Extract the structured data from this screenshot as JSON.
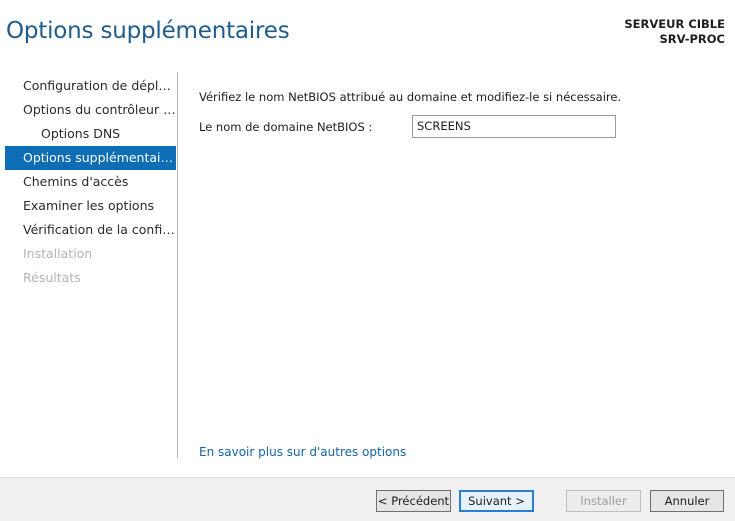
{
  "header": {
    "title": "Options supplémentaires",
    "target_label": "SERVEUR CIBLE",
    "target_server": "SRV-PROC"
  },
  "nav": {
    "items": [
      {
        "label": "Configuration de déploie..."
      },
      {
        "label": "Options du contrôleur de..."
      },
      {
        "label": "Options DNS"
      },
      {
        "label": "Options supplémentaires"
      },
      {
        "label": "Chemins d'accès"
      },
      {
        "label": "Examiner les options"
      },
      {
        "label": "Vérification de la configur..."
      },
      {
        "label": "Installation"
      },
      {
        "label": "Résultats"
      }
    ]
  },
  "content": {
    "description": "Vérifiez le nom NetBIOS attribué au domaine et modifiez-le si nécessaire.",
    "netbios_label": "Le nom de domaine NetBIOS :",
    "netbios_value": "SCREENS",
    "more_link": "En savoir plus sur d'autres options"
  },
  "footer": {
    "previous": "< Précédent",
    "next": "Suivant >",
    "install": "Installer",
    "cancel": "Annuler"
  },
  "colors": {
    "accent": "#0d6eb5",
    "title": "#1e5c8e",
    "link": "#1565a8",
    "disabled": "#b4b4b4"
  }
}
